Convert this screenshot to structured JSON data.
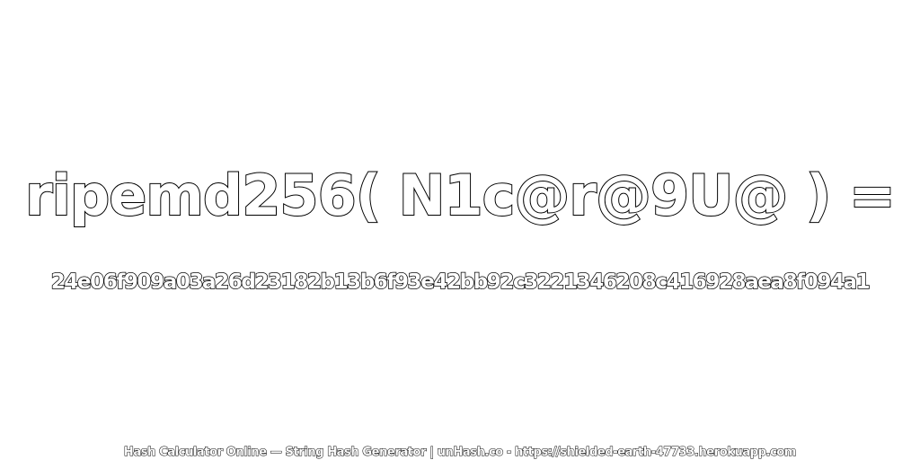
{
  "heading": "ripemd256( N1c@r@9U@ ) =",
  "hash_value": "24e06f909a03a26d23182b13b6f93e42bb92c3221346208c416928aea8f094a1",
  "footer": "Hash Calculator Online — String Hash Generator | unHash.co - https://shielded-earth-47733.herokuapp.com",
  "colors": {
    "background": "#ffffff",
    "text_fill": "#ffffff",
    "text_outline": "#000000"
  }
}
